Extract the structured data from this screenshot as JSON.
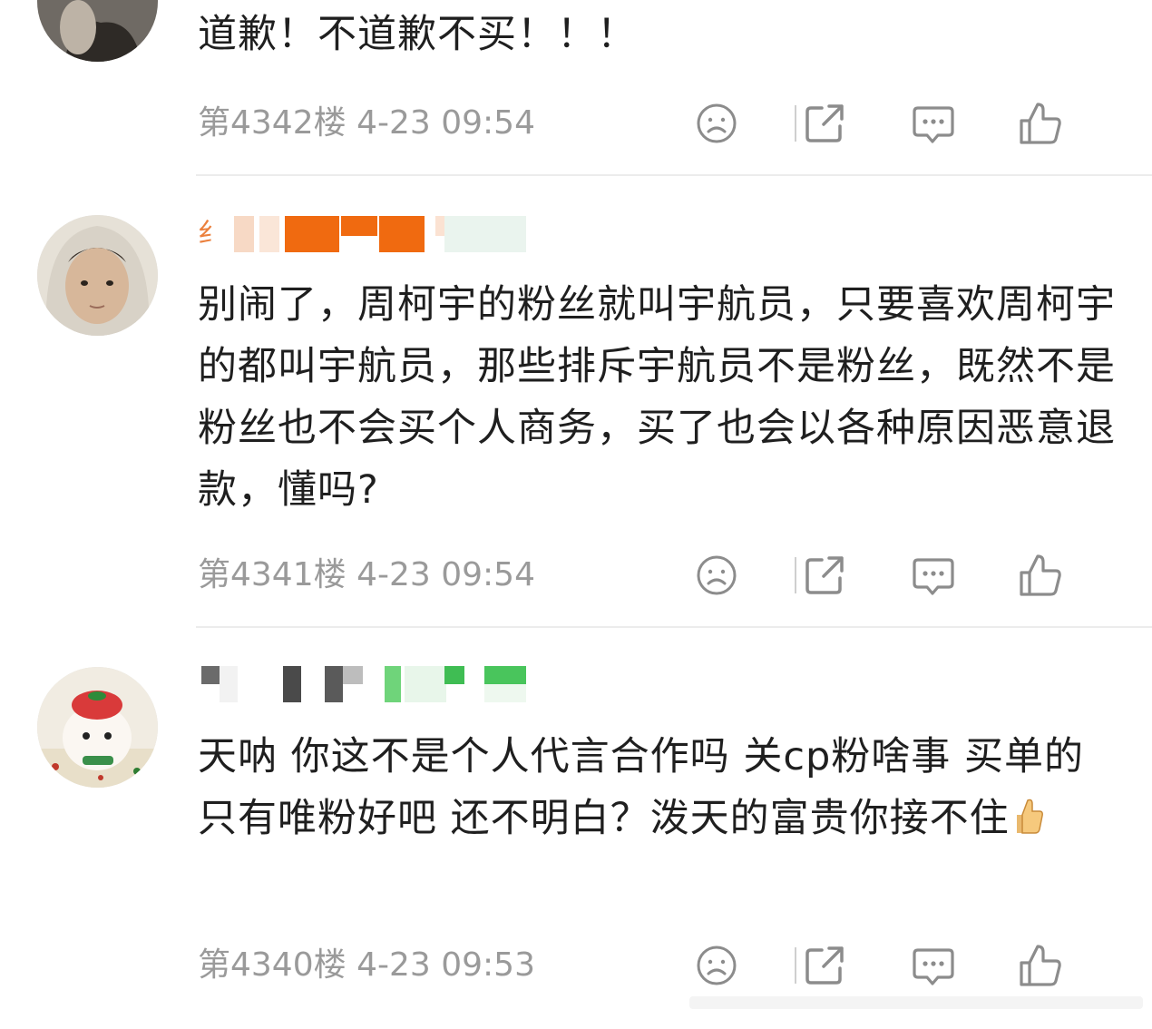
{
  "comments": [
    {
      "name": "",
      "text": "道歉！不道歉不买！！！",
      "floor": "第4342楼",
      "time": "4-23 09:54"
    },
    {
      "name": "纟",
      "text": "别闹了，周柯宇的粉丝就叫宇航员，只要喜欢周柯宇的都叫宇航员，那些排斥宇航员不是粉丝，既然不是粉丝也不会买个人商务，买了也会以各种原因恶意退款，懂吗?",
      "floor": "第4341楼",
      "time": "4-23 09:54"
    },
    {
      "name": "",
      "text": "天呐 你这不是个人代言合作吗 关cp粉啥事 买单的只有唯粉好吧 还不明白？泼天的富贵你接不住",
      "floor": "第4340楼",
      "time": "4-23 09:53"
    }
  ],
  "icons": {
    "dislike": "sad-face-icon",
    "share": "share-icon",
    "reply": "comment-icon",
    "like": "thumbs-up-icon"
  },
  "colors": {
    "meta": "#9a9a9a",
    "name_accent": "#e86a1c",
    "body": "#1f1f1f"
  }
}
